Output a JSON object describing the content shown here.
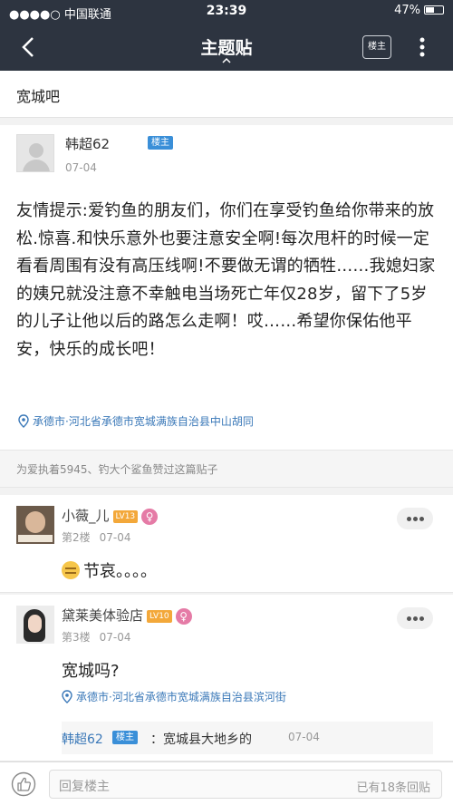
{
  "status_bar": {
    "carrier": "●●●●○ 中国联通",
    "time": "23:39",
    "battery": "47%"
  },
  "nav": {
    "title": "主题贴",
    "owner_label": "楼主"
  },
  "forum": {
    "name": "宽城吧"
  },
  "op": {
    "author": "韩超62",
    "badge": "楼主",
    "date": "07-04",
    "body": "友情提示:爱钓鱼的朋友们，你们在享受钓鱼给你带来的放松.惊喜.和快乐意外也要注意安全啊!每次甩杆的时候一定看看周围有没有高压线啊!不要做无谓的牺牲……我媳妇家的姨兄就没注意不幸触电当场死亡年仅28岁，留下了5岁的儿子让他以后的路怎么走啊！哎……希望你保佑他平安，快乐的成长吧！",
    "location": "承德市·河北省承德市宽城满族自治县中山胡同"
  },
  "likes": {
    "text": "为爱执着5945、钓大个鲨鱼赞过这篇贴子"
  },
  "replies": [
    {
      "author": "小薇_儿",
      "level": "LV13",
      "gender": "♀",
      "floor": "第2楼",
      "date": "07-04",
      "body": "节哀。。。。"
    },
    {
      "author": "黛莱美体验店",
      "level": "LV10",
      "gender": "♀",
      "floor": "第3楼",
      "date": "07-04",
      "body": "宽城吗?",
      "location": "承德市·河北省承德市宽城满族自治县滨河街",
      "sub_reply": {
        "author": "韩超62",
        "badge": "楼主",
        "text": "：宽城县大地乡的",
        "date": "07-04"
      }
    }
  ],
  "bottom": {
    "placeholder": "回复楼主",
    "reply_count": "已有18条回贴"
  },
  "colors": {
    "nav_bg": "#2d3440",
    "badge_blue": "#3a8fd8",
    "level_orange": "#f3a83a",
    "female_pink": "#e57ba6",
    "link_blue": "#3a78b8"
  }
}
